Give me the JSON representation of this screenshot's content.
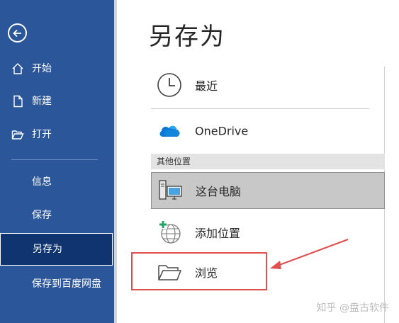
{
  "sidebar": {
    "items": [
      {
        "label": "开始",
        "icon": "home-icon"
      },
      {
        "label": "新建",
        "icon": "new-document-icon"
      },
      {
        "label": "打开",
        "icon": "open-folder-icon"
      },
      {
        "label": "信息"
      },
      {
        "label": "保存"
      },
      {
        "label": "另存为",
        "selected": true
      },
      {
        "label": "保存到百度网盘"
      }
    ]
  },
  "main": {
    "title": "另存为",
    "locations": [
      {
        "label": "最近",
        "icon": "clock-icon"
      },
      {
        "label": "OneDrive",
        "icon": "onedrive-cloud-icon"
      }
    ],
    "section_header": "其他位置",
    "other_locations": [
      {
        "label": "这台电脑",
        "icon": "computer-icon",
        "selected": true
      },
      {
        "label": "添加位置",
        "icon": "add-location-globe-icon"
      },
      {
        "label": "浏览",
        "icon": "folder-icon",
        "highlighted": true
      }
    ]
  },
  "watermark": "知乎 @盘古软件",
  "colors": {
    "sidebar_bg": "#2b579a",
    "sidebar_selected_bg": "#0f3470",
    "highlight": "#e05050",
    "onedrive_blue": "#0f78d4"
  }
}
